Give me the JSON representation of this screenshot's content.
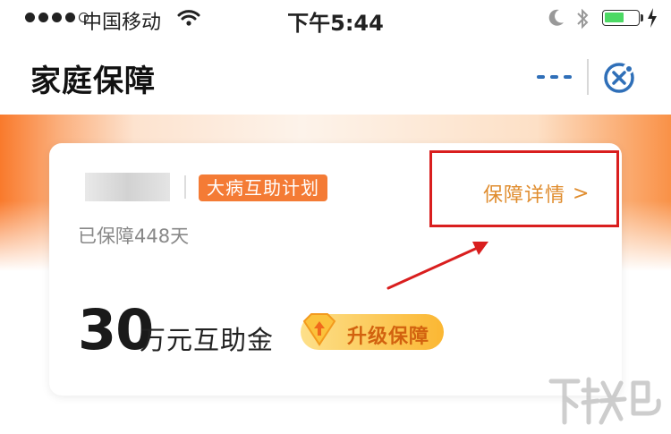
{
  "status_bar": {
    "carrier": "中国移动",
    "time": "下午5:44",
    "battery_level": 0.62,
    "colors": {
      "battery": "#4cd964"
    }
  },
  "header": {
    "title": "家庭保障",
    "more_icon": "more-dots-icon",
    "close_icon": "close-circle-icon",
    "colors": {
      "capsule_icon": "#2f6fb8"
    }
  },
  "card": {
    "plan_tag": "大病互助计划",
    "days_label": "已保障448天",
    "detail_link": "保障详情",
    "detail_chevron": ">",
    "amount_value": "30",
    "amount_unit": "万元互助金",
    "upgrade_label": "升级保障",
    "colors": {
      "tag_bg": "#f47b35",
      "link": "#e08d2f",
      "highlight": "#d91e1e",
      "upgrade_text": "#d2620f"
    }
  },
  "watermark": {
    "icon": "xiazaiba-logo-icon"
  }
}
